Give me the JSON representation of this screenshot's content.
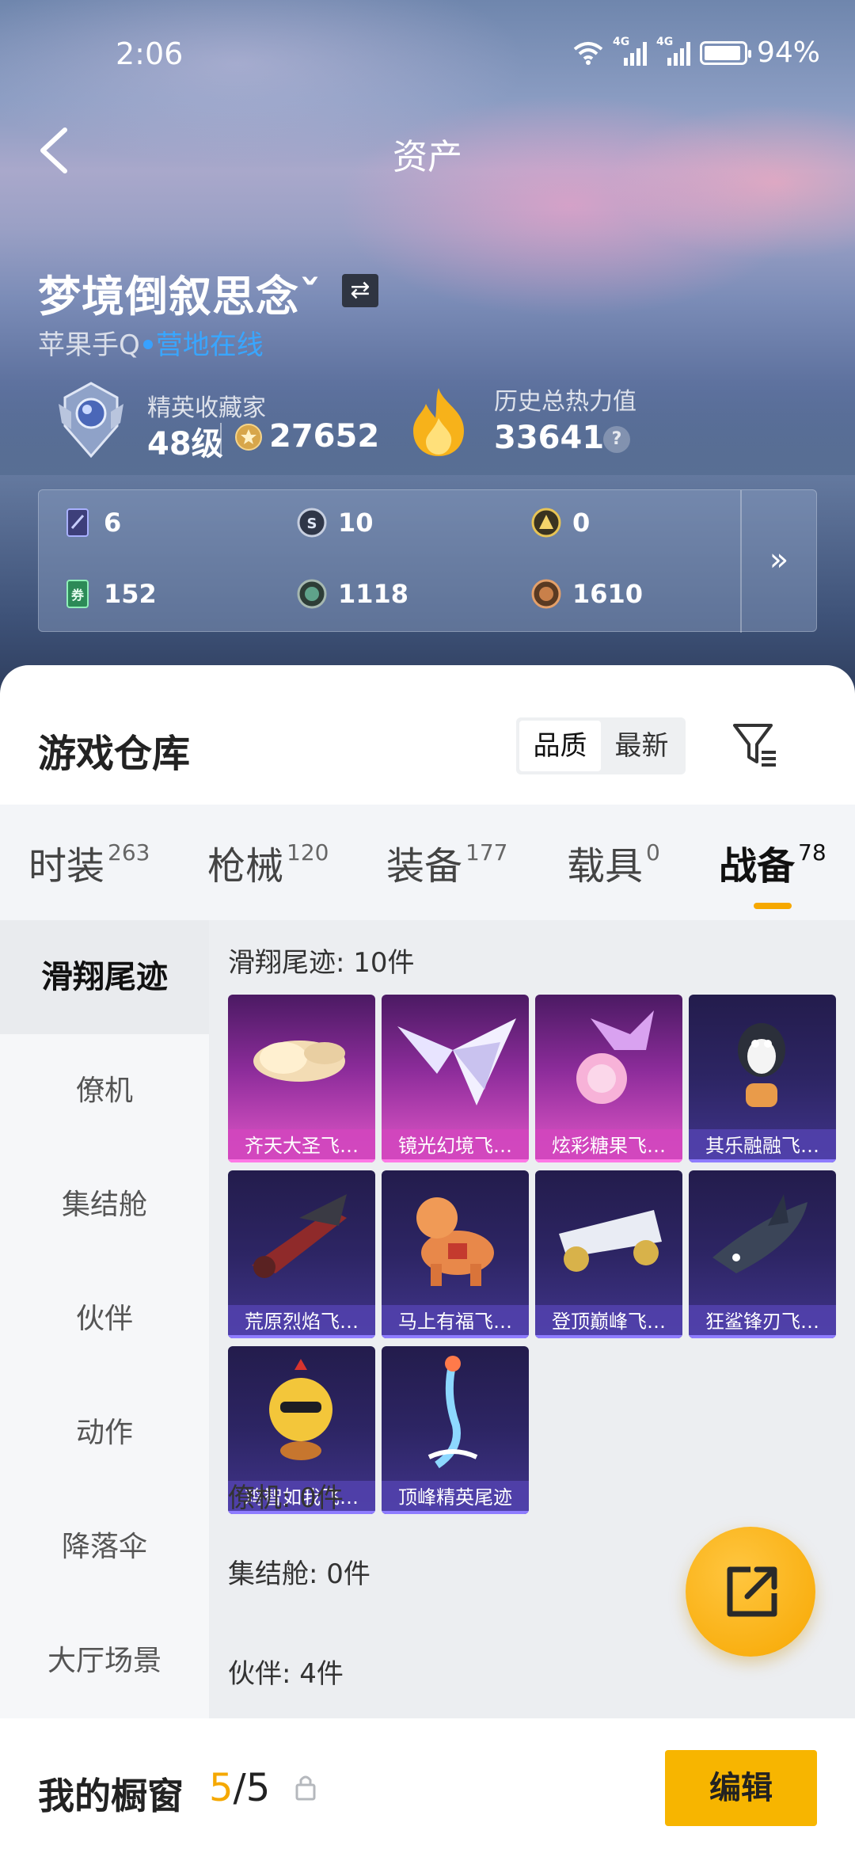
{
  "status_bar": {
    "time": "2:06",
    "battery": "94%",
    "network1": "4G",
    "network2": "4G"
  },
  "nav": {
    "title": "资产"
  },
  "profile": {
    "name": "梦境倒叙思念ˇ",
    "platform": "苹果手Q",
    "online_status": "营地在线",
    "rank_title": "精英收藏家",
    "level": "48级",
    "points": "27652",
    "heat_label": "历史总热力值",
    "heat_value": "33641",
    "help": "?"
  },
  "currencies": [
    {
      "value": "6",
      "icon": "card-icon"
    },
    {
      "value": "10",
      "icon": "silver-coin-icon"
    },
    {
      "value": "0",
      "icon": "gold-coin-icon"
    },
    {
      "value": "152",
      "icon": "ticket-icon"
    },
    {
      "value": "1118",
      "icon": "green-orb-icon"
    },
    {
      "value": "1610",
      "icon": "bronze-coin-icon"
    }
  ],
  "currency_more": "»",
  "warehouse": {
    "title": "游戏仓库",
    "sort_options": [
      "品质",
      "最新"
    ],
    "active_sort": "品质"
  },
  "tabs": [
    {
      "label": "时装",
      "count": "263"
    },
    {
      "label": "枪械",
      "count": "120"
    },
    {
      "label": "装备",
      "count": "177"
    },
    {
      "label": "载具",
      "count": "0"
    },
    {
      "label": "战备",
      "count": "78"
    }
  ],
  "left_nav": [
    "滑翔尾迹",
    "僚机",
    "集结舱",
    "伙伴",
    "动作",
    "降落伞",
    "大厅场景"
  ],
  "sections": {
    "glide_header": "滑翔尾迹: 10件",
    "wingman_header": "僚机: 0件",
    "capsule_header": "集结舱: 0件",
    "partner_header": "伙伴: 4件"
  },
  "items": [
    {
      "label": "齐天大圣飞…",
      "rarity": "pink",
      "icon": "golden-cloud-icon"
    },
    {
      "label": "镜光幻境飞…",
      "rarity": "pink",
      "icon": "crystal-wings-icon"
    },
    {
      "label": "炫彩糖果飞…",
      "rarity": "pink",
      "icon": "candy-icon"
    },
    {
      "label": "其乐融融飞…",
      "rarity": "purple",
      "icon": "penguin-icon"
    },
    {
      "label": "荒原烈焰飞…",
      "rarity": "purple",
      "icon": "red-jet-icon"
    },
    {
      "label": "马上有福飞…",
      "rarity": "purple",
      "icon": "toy-horse-icon"
    },
    {
      "label": "登顶巅峰飞…",
      "rarity": "purple",
      "icon": "white-jet-icon"
    },
    {
      "label": "狂鲨锋刃飞…",
      "rarity": "purple",
      "icon": "shark-icon"
    },
    {
      "label": "鸡智如我飞…",
      "rarity": "purple",
      "icon": "chicken-icon"
    },
    {
      "label": "顶峰精英尾迹",
      "rarity": "purple",
      "icon": "smoke-trail-icon"
    }
  ],
  "showcase": {
    "title": "我的橱窗",
    "current": "5",
    "total": "/5",
    "edit": "编辑"
  },
  "colors": {
    "accent": "#f7b500",
    "online": "#39a6ff",
    "pink_rarity": "#c448b8",
    "purple_rarity": "#4b3c9e"
  }
}
